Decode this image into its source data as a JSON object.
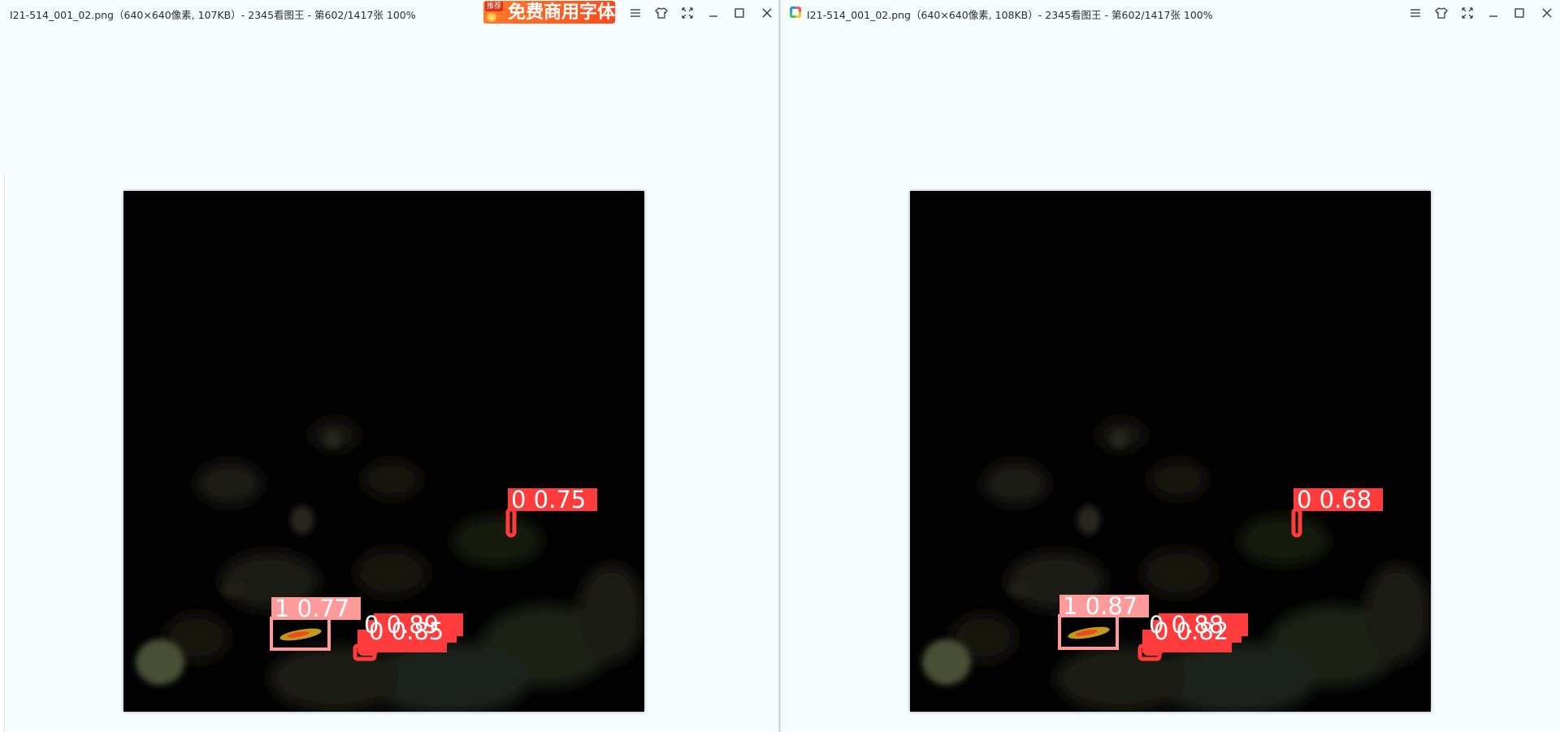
{
  "left_window": {
    "title": "I21-514_001_02.png（640×640像素, 107KB）- 2345看图王 - 第602/1417张 100%",
    "ad": {
      "tag": "推荐",
      "text": "免费商用字体"
    },
    "detections": [
      {
        "label": "0 0.75",
        "color": "#ff3b3b"
      },
      {
        "label": "1 0.77",
        "color": "#ff9a9a"
      },
      {
        "label": "0 0.89",
        "color": "#ff3b3b"
      },
      {
        "label": "0 0.85",
        "color": "#ff3b3b"
      }
    ]
  },
  "right_window": {
    "title": "I21-514_001_02.png（640×640像素, 108KB）- 2345看图王 - 第602/1417张 100%",
    "detections": [
      {
        "label": "0 0.68",
        "color": "#ff3b3b"
      },
      {
        "label": "1 0.87",
        "color": "#ff9a9a"
      },
      {
        "label": "0 0.88",
        "color": "#ff3b3b"
      },
      {
        "label": "0 0.82",
        "color": "#ff3b3b"
      }
    ]
  },
  "colors": {
    "background": "#f6fbfe",
    "class0_box": "#ff3b3b",
    "class1_box": "#ff9a9a",
    "ad_banner": "#ff5a22"
  },
  "icons": [
    "app-logo-icon",
    "menu-icon",
    "skin-icon",
    "fullscreen-icon",
    "minimize-icon",
    "maximize-icon",
    "close-icon"
  ]
}
